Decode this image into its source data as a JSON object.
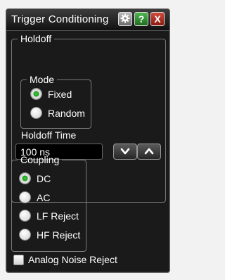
{
  "window": {
    "title": "Trigger Conditioning"
  },
  "titlebar": {
    "buttons": [
      {
        "icon": "gear-icon",
        "label": ""
      },
      {
        "icon": "help-icon",
        "label": "?"
      },
      {
        "icon": "close-icon",
        "label": "X"
      }
    ]
  },
  "holdoff": {
    "group_label": "Holdoff",
    "mode": {
      "group_label": "Mode",
      "options": [
        {
          "label": "Fixed",
          "selected": true
        },
        {
          "label": "Random",
          "selected": false
        }
      ]
    },
    "time": {
      "label": "Holdoff Time",
      "value": "100 ns"
    },
    "spin_buttons": [
      "decrease",
      "increase"
    ]
  },
  "coupling": {
    "group_label": "Coupling",
    "options": [
      {
        "label": "DC",
        "selected": true
      },
      {
        "label": "AC",
        "selected": false
      },
      {
        "label": "LF Reject",
        "selected": false
      },
      {
        "label": "HF Reject",
        "selected": false
      }
    ]
  },
  "analog_noise_reject": {
    "label": "Analog Noise Reject",
    "checked": false
  },
  "colors": {
    "background": "#1a1a1a",
    "selected_radio": "#2eb82e",
    "help_button": "#2e8b2e",
    "close_button": "#b3261e"
  }
}
